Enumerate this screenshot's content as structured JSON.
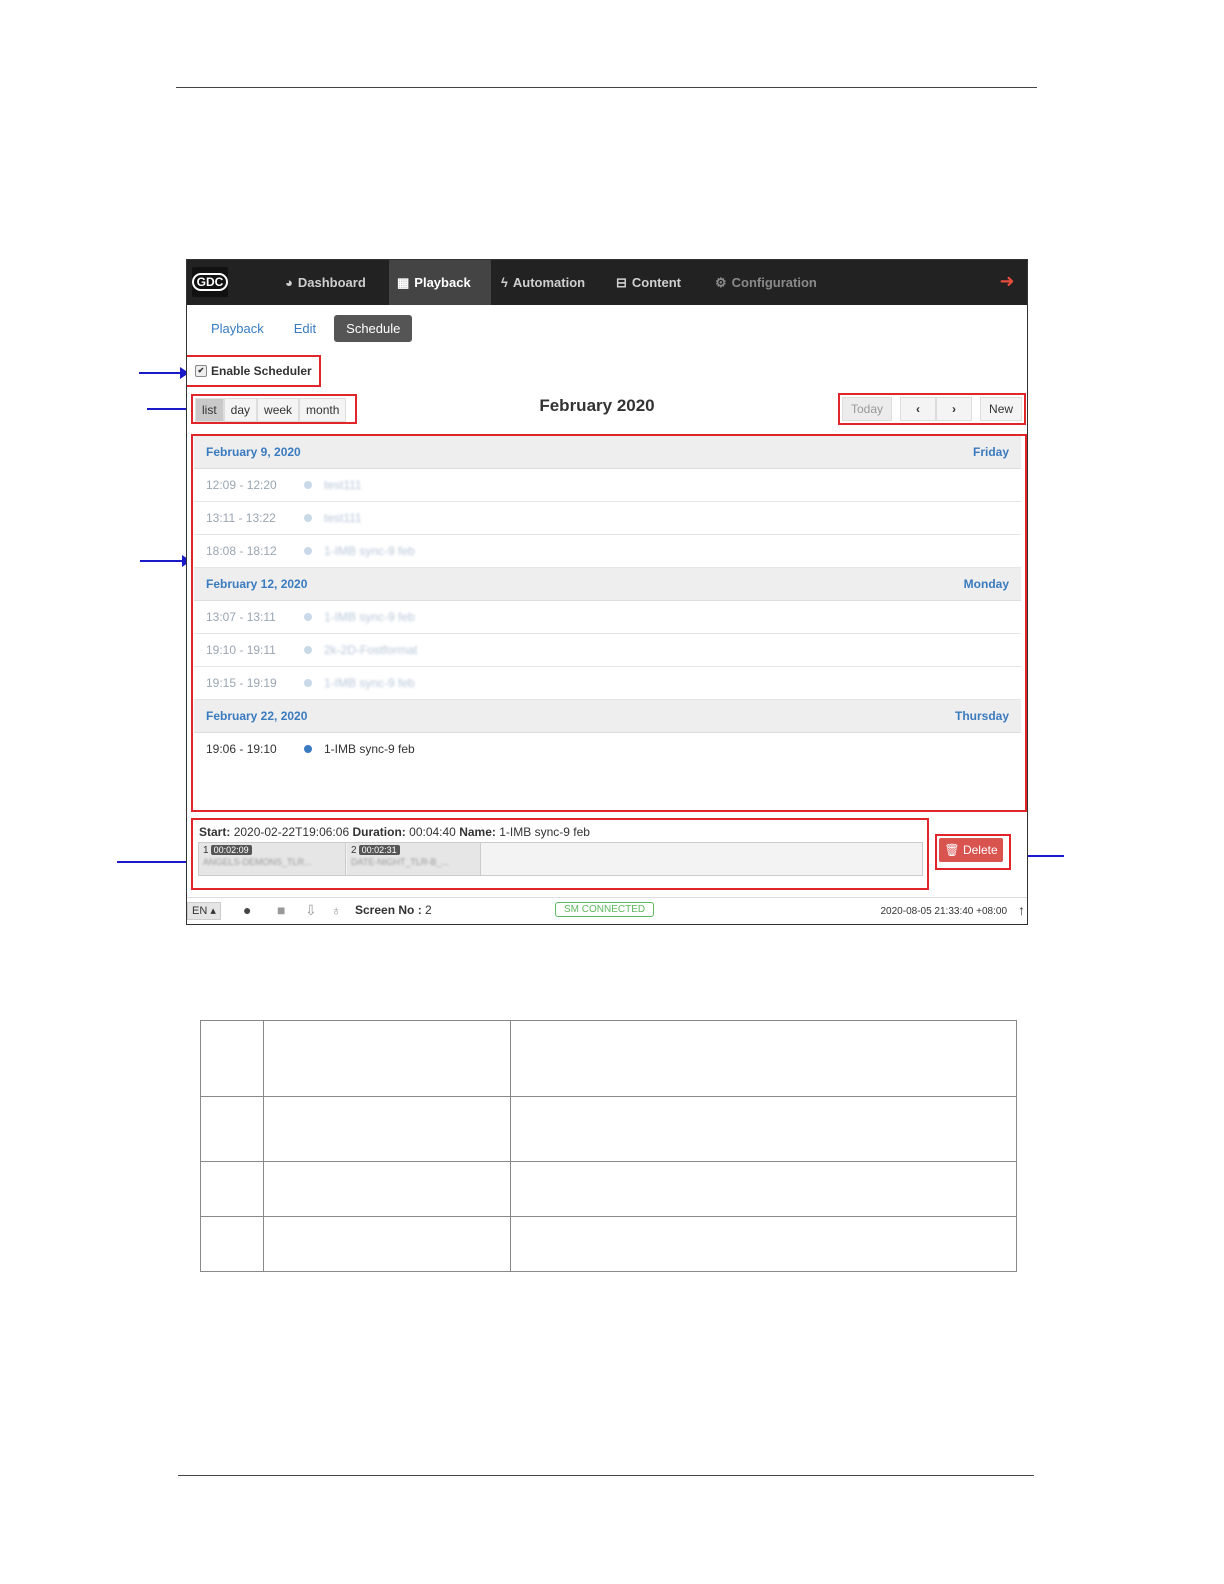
{
  "nav": {
    "logo": "GDC",
    "items": [
      {
        "label": "Dashboard",
        "icon": "dashboard-icon"
      },
      {
        "label": "Playback",
        "icon": "film-icon"
      },
      {
        "label": "Automation",
        "icon": "bolt-icon"
      },
      {
        "label": "Content",
        "icon": "hdd-icon"
      },
      {
        "label": "Configuration",
        "icon": "gears-icon"
      }
    ]
  },
  "subtabs": [
    "Playback",
    "Edit",
    "Schedule"
  ],
  "scheduler": {
    "enable_label": "Enable Scheduler",
    "views": [
      "list",
      "day",
      "week",
      "month"
    ],
    "title": "February 2020",
    "today": "Today",
    "prev": "‹",
    "next": "›",
    "new": "New"
  },
  "events": [
    {
      "date": "February 9, 2020",
      "weekday": "Friday",
      "items": [
        {
          "time": "12:09 - 12:20",
          "name": "test111"
        },
        {
          "time": "13:11 - 13:22",
          "name": "test111"
        },
        {
          "time": "18:08 - 18:12",
          "name": "1-IMB sync-9 feb"
        }
      ]
    },
    {
      "date": "February 12, 2020",
      "weekday": "Monday",
      "items": [
        {
          "time": "13:07 - 13:11",
          "name": "1-IMB sync-9 feb"
        },
        {
          "time": "19:10 - 19:11",
          "name": "2k-2D-Fostformat"
        },
        {
          "time": "19:15 - 19:19",
          "name": "1-IMB sync-9 feb"
        }
      ]
    },
    {
      "date": "February 22, 2020",
      "weekday": "Thursday",
      "items": [
        {
          "time": "19:06 - 19:10",
          "name": "1-IMB sync-9 feb"
        }
      ]
    }
  ],
  "detail": {
    "start_label": "Start:",
    "start": "2020-02-22T19:06:06",
    "duration_label": "Duration:",
    "duration": "00:04:40",
    "name_label": "Name:",
    "name": "1-IMB sync-9 feb",
    "clips": [
      {
        "index": "1",
        "duration": "00:02:09",
        "name": "ANGELS-DEMONS_TLR..."
      },
      {
        "index": "2",
        "duration": "00:02:31",
        "name": "DATE-NIGHT_TLR-B_..."
      }
    ],
    "delete_label": "Delete"
  },
  "status": {
    "lang": "EN ▴",
    "screen_label": "Screen No :",
    "screen_no": "2",
    "sm": "SM CONNECTED",
    "clock": "2020-08-05 21:33:40 +08:00"
  }
}
